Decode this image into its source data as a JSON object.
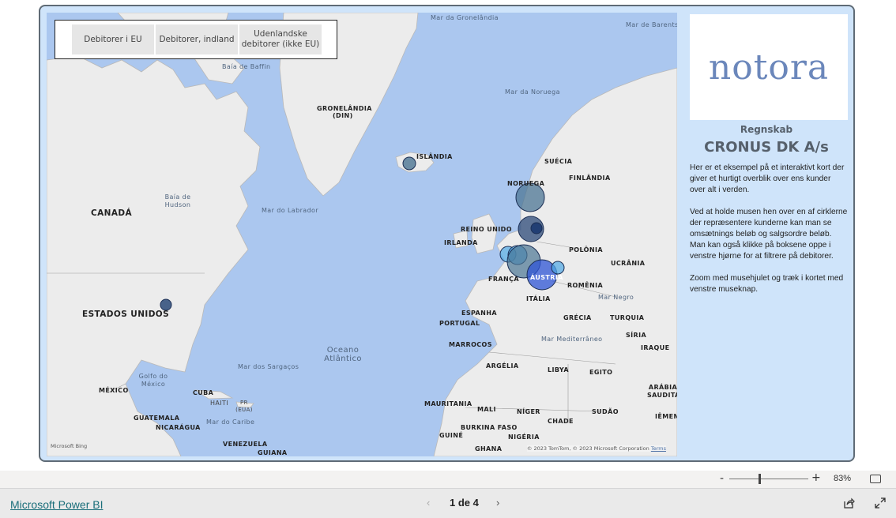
{
  "slicer": {
    "buttons": [
      "Debitorer i EU",
      "Debitorer, indland",
      "Udenlandske debitorer (ikke EU)"
    ]
  },
  "map": {
    "labels": {
      "greenland_sea": "Mar da Gronelândia",
      "barents": "Mar de Barents",
      "baffin": "Baía de Baffin",
      "greenland": "GRONELÂNDIA",
      "greenland_dk": "(DIN)",
      "norway_sea": "Mar da Noruega",
      "iceland": "ISLÂNDIA",
      "sweden": "SUÉCIA",
      "finland": "FINLÂNDIA",
      "norway": "NORUEGA",
      "hudson": "Baía de Hudson",
      "canada": "CANADÁ",
      "labrador": "Mar do Labrador",
      "uk": "REINO UNIDO",
      "ireland": "IRLANDA",
      "poland": "POLÔNIA",
      "ukraine": "UCRÂNIA",
      "france": "FRANÇA",
      "austria": "ÁUSTRIA",
      "romania": "ROMÊNIA",
      "black_sea": "Mar Negro",
      "italy": "ITÁLIA",
      "usa": "ESTADOS UNIDOS",
      "spain": "ESPANHA",
      "portugal": "PORTUGAL",
      "greece": "GRÉCIA",
      "turkey": "TURQUIA",
      "mediterranean": "Mar Mediterrâneo",
      "syria": "SÍRIA",
      "morocco": "MARROCOS",
      "iraq": "IRAQUE",
      "atlantic": "Oceano Atlântico",
      "algeria": "ARGÉLIA",
      "libya": "LIBYA",
      "egypt": "EGITO",
      "sargasso": "Mar dos Sargaços",
      "gulf_mexico": "Golfo do México",
      "mexico": "MÉXICO",
      "cuba": "CUBA",
      "saudi": "ARÁBIA SAUDITA",
      "haiti": "HAITI",
      "pr": "PR (EUA)",
      "mauritania": "MAURITANIA",
      "mali": "MALI",
      "niger": "NÍGER",
      "chad": "CHADE",
      "sudan": "SUDÃO",
      "yemen": "IÊMEN",
      "guatemala": "GUATEMALA",
      "nicaragua": "NICARÁGUA",
      "caribbean": "Mar do Caribe",
      "burkina": "BURKINA FASO",
      "guinea": "GUINÉ",
      "nigeria": "NIGÉRIA",
      "venezuela": "VENEZUELA",
      "guiana": "GUIANA",
      "ghana": "GHANA"
    },
    "bing": "Microsoft Bing",
    "copyright": "© 2023 TomTom, © 2023 Microsoft Corporation",
    "terms": "Terms"
  },
  "sidebar": {
    "logo": "notora",
    "subtitle": "Regnskab",
    "company": "CRONUS DK A/s",
    "description": "Her er et eksempel på et interaktivt kort der giver et hurtigt overblik over ens kunder over alt i verden.\n\nVed at holde musen hen over en af cirklerne der repræsentere kunderne kan man se omsætnings beløb og salgsordre beløb.\nMan kan også klikke på boksene oppe i venstre hjørne for at filtrere på debitorer.\n\nZoom med musehjulet og træk i kortet med venstre museknap."
  },
  "zoom": {
    "minus": "-",
    "plus": "+",
    "percent": "83%",
    "level": 0.4
  },
  "footer": {
    "brand": "Microsoft Power BI",
    "page": "1 de 4",
    "prev": "‹",
    "next": "›"
  },
  "colors": {
    "water": "#abc7ef",
    "land": "#ececec",
    "panel": "#cfe4fa",
    "logo_text": "#6b87bb",
    "bubble_dark": "#2c4a78",
    "bubble_teal": "#4c7694",
    "bubble_blue": "#2f55d6",
    "bubble_light": "#4fa8e6"
  },
  "icons": [
    "fit-to-page-icon",
    "share-icon",
    "expand-icon",
    "chevron-left-icon",
    "chevron-right-icon"
  ]
}
